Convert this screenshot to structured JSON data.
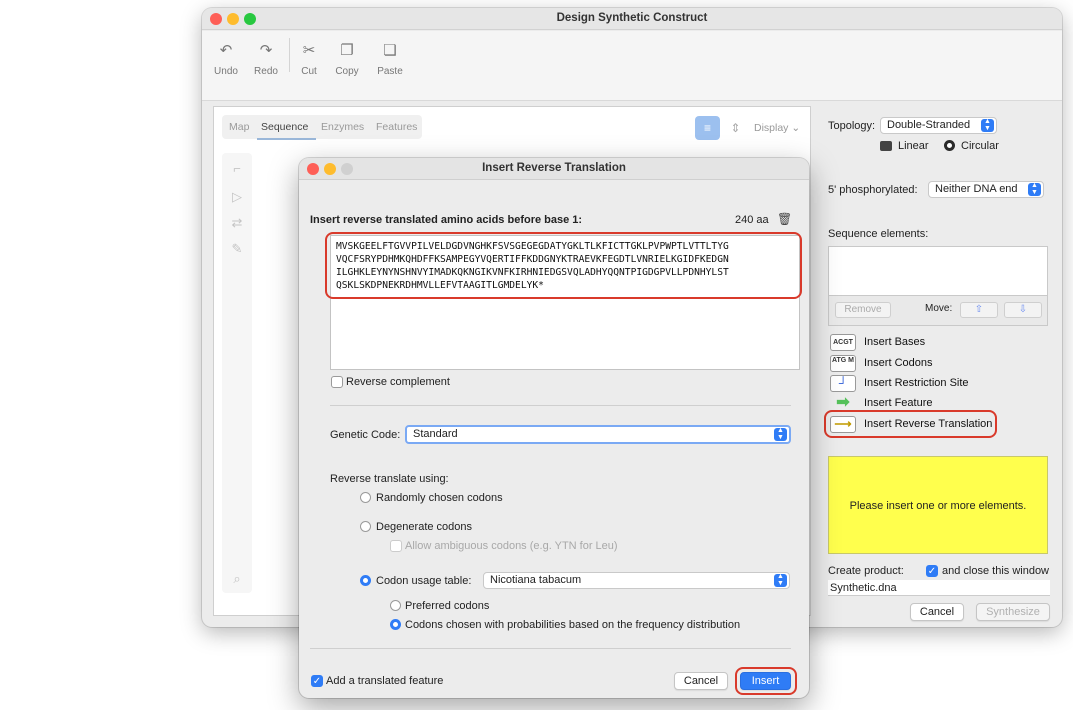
{
  "main_window": {
    "title": "Design Synthetic Construct",
    "toolbar": {
      "undo": "Undo",
      "redo": "Redo",
      "cut": "Cut",
      "copy": "Copy",
      "paste": "Paste"
    },
    "tabs": [
      "Map",
      "Sequence",
      "Enzymes",
      "Features"
    ],
    "active_tab": "Sequence",
    "display_label": "Display",
    "right_panel": {
      "topology_label": "Topology:",
      "topology_value": "Double-Stranded",
      "linear_label": "Linear",
      "circular_label": "Circular",
      "phosphorylated_label": "5' phosphorylated:",
      "phosphorylated_value": "Neither DNA end",
      "sequence_elements_label": "Sequence elements:",
      "remove_label": "Remove",
      "move_label": "Move:",
      "inserts": [
        {
          "icon_text": "ACGT",
          "label": "Insert Bases"
        },
        {
          "icon_text": "ATG M",
          "label": "Insert Codons"
        },
        {
          "icon_text": "",
          "label": "Insert Restriction Site"
        },
        {
          "icon_text": "",
          "label": "Insert Feature"
        },
        {
          "icon_text": "",
          "label": "Insert Reverse Translation"
        }
      ],
      "placeholder_message": "Please insert one or more elements.",
      "create_product_label": "Create product:",
      "close_window_label": "and close this window",
      "product_name": "Synthetic.dna",
      "cancel_label": "Cancel",
      "synthesize_label": "Synthesize"
    }
  },
  "dialog": {
    "title": "Insert Reverse Translation",
    "instruction": "Insert reverse translated amino acids before base 1:",
    "aa_count": "240 aa",
    "amino_acids": "MVSKGEELFTGVVPILVELDGDVNGHKFSVSGEGEGDATYGKLTLKFICTTGKLPVPWPTLVTTLTYGVQCFSRYPDHMKQHDFFKSAMPEGYVQERTIFFKDDGNYKTRAEVKFEGDTLVNRIELKGIDFKEDGNILGHKLEYNYNSHNVYIMADKQKNGIKVNFKIRHNIEDGSVQLADHYQQNTPIGDGPVLLPDNHYLSTQSKLSKDPNEKRDHMVLLEFVTAAGITLGMDELYK*",
    "reverse_complement_label": "Reverse complement",
    "genetic_code_label": "Genetic Code:",
    "genetic_code_value": "Standard",
    "reverse_translate_label": "Reverse translate using:",
    "options": {
      "random": "Randomly chosen codons",
      "degenerate": "Degenerate codons",
      "ambiguous": "Allow ambiguous codons (e.g. YTN for Leu)",
      "codon_usage": "Codon usage table:",
      "codon_usage_value": "Nicotiana tabacum",
      "preferred": "Preferred codons",
      "probabilistic": "Codons chosen with probabilities based on the frequency distribution"
    },
    "add_feature_label": "Add a translated feature",
    "cancel_label": "Cancel",
    "insert_label": "Insert"
  },
  "colors": {
    "accent": "#2f7cf6",
    "highlight": "#d93a2b",
    "placeholder_bg": "#ffff4d"
  }
}
